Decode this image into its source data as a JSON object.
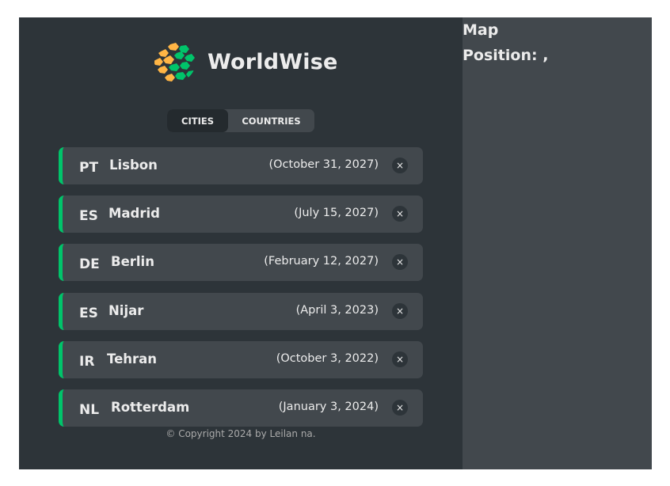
{
  "logo": {
    "text": "WorldWise",
    "icon": "globe-logo-icon"
  },
  "tabs": [
    {
      "label": "CITIES",
      "active": true
    },
    {
      "label": "COUNTRIES",
      "active": false
    }
  ],
  "cities": [
    {
      "flag": "PT",
      "name": "Lisbon",
      "date": "(October 31, 2027)"
    },
    {
      "flag": "ES",
      "name": "Madrid",
      "date": "(July 15, 2027)"
    },
    {
      "flag": "DE",
      "name": "Berlin",
      "date": "(February 12, 2027)"
    },
    {
      "flag": "ES",
      "name": "Nijar",
      "date": "(April 3, 2023)"
    },
    {
      "flag": "IR",
      "name": "Tehran",
      "date": "(October 3, 2022)"
    },
    {
      "flag": "NL",
      "name": "Rotterdam",
      "date": "(January 3, 2024)"
    }
  ],
  "delete_symbol": "×",
  "footer": {
    "copyright": "© Copyright 2024 by Leilan na."
  },
  "map": {
    "title": "Map",
    "position": "Position: ,"
  },
  "colors": {
    "sidebar_bg": "#2d3439",
    "map_bg": "#42484d",
    "accent_green": "#00c46a",
    "logo_orange": "#ffb545"
  }
}
